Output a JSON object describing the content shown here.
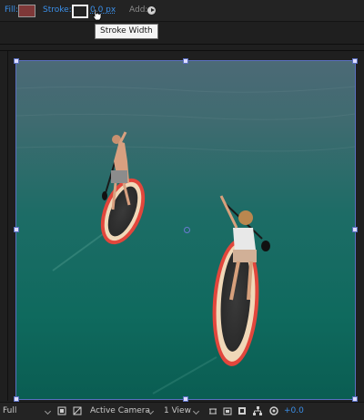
{
  "toolbar": {
    "fill_label": "Fill:",
    "fill_color": "#7e3838",
    "stroke_label": "Stroke:",
    "stroke_color": "#ffffff",
    "stroke_width": "0.0 px",
    "add_label": "Add:",
    "add_icon": "play-circle-icon",
    "tooltip": "Stroke Width"
  },
  "viewer": {
    "content": "aerial photo of two paddle boarders on teal water",
    "selection_color": "#5a6fc0"
  },
  "bottombar": {
    "resolution": "Full",
    "camera": "Active Camera",
    "views": "1 View",
    "exposure_offset": "+0.0",
    "icons": [
      "region-of-interest-icon",
      "transparency-grid-icon",
      "fast-preview-icon",
      "snapshot-icon",
      "show-snapshot-icon",
      "flowchart-icon",
      "reset-exposure-icon"
    ]
  },
  "colors": {
    "panel_bg": "#1f1f1f",
    "accent_blue": "#3b8fe8"
  }
}
